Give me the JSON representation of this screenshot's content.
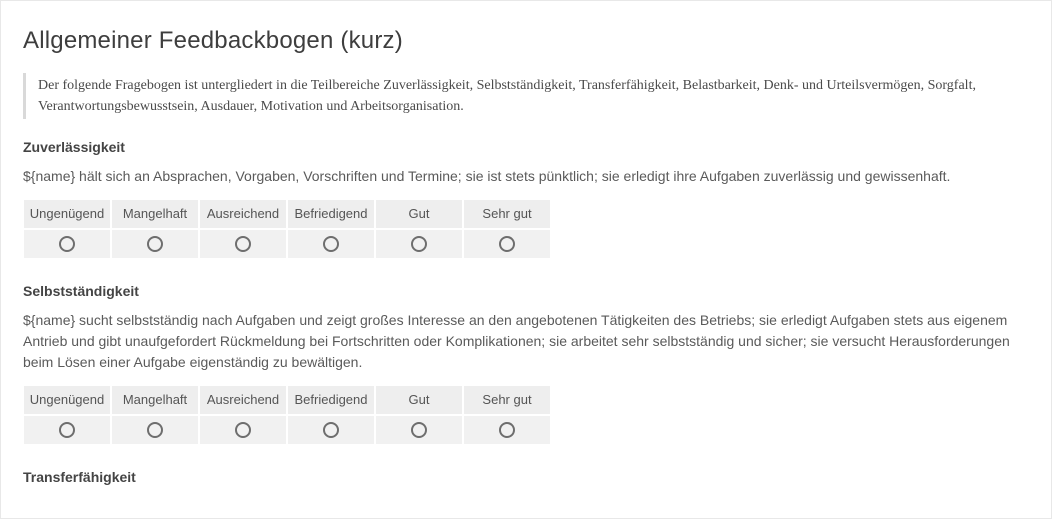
{
  "title": "Allgemeiner Feedbackbogen (kurz)",
  "intro": "Der folgende Fragebogen ist untergliedert in die Teilbereiche Zuverlässigkeit, Selbstständigkeit, Transferfähigkeit, Belastbarkeit, Denk- und Urteilsvermögen, Sorgfalt, Verantwortungsbewusstsein, Ausdauer, Motivation und Arbeitsorganisation.",
  "rating_labels": [
    "Ungenügend",
    "Mangelhaft",
    "Ausreichend",
    "Befriedigend",
    "Gut",
    "Sehr gut"
  ],
  "sections": [
    {
      "heading": "Zuverlässigkeit",
      "description": "${name} hält sich an Absprachen, Vorgaben, Vorschriften und Termine; sie ist stets pünktlich; sie erledigt ihre Aufgaben zuverlässig und gewissenhaft."
    },
    {
      "heading": "Selbstständigkeit",
      "description": "${name} sucht selbstständig nach Aufgaben und zeigt großes Interesse an den angebotenen Tätigkeiten des Betriebs; sie erledigt Aufgaben stets aus eigenem Antrieb und gibt unaufgefordert Rückmeldung bei Fortschritten oder Komplikationen; sie arbeitet sehr selbstständig und sicher; sie versucht Herausforderungen beim Lösen einer Aufgabe eigenständig zu bewältigen."
    },
    {
      "heading": "Transferfähigkeit",
      "description": ""
    }
  ]
}
